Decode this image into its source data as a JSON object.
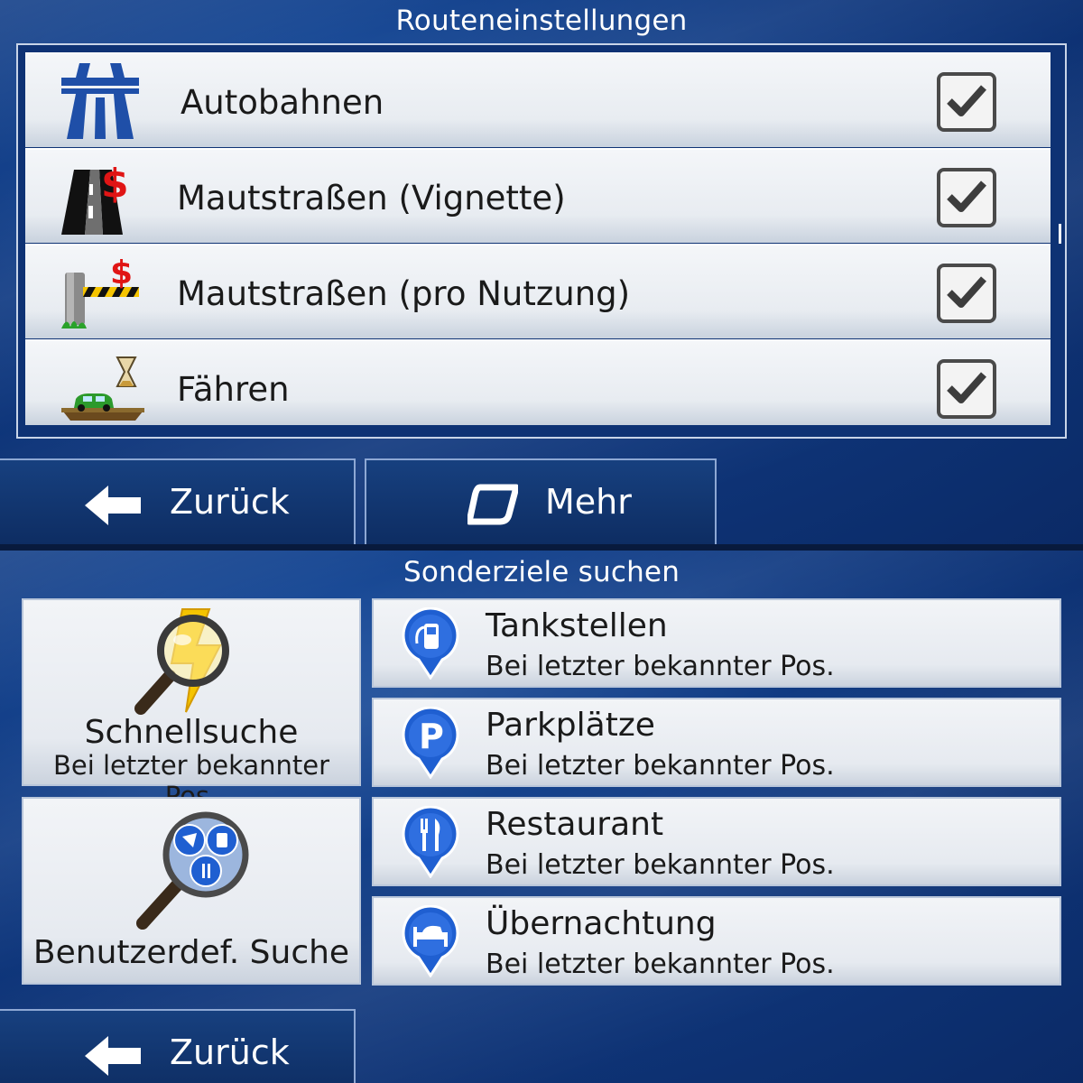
{
  "route_settings": {
    "title": "Routeneinstellungen",
    "items": [
      {
        "label": "Autobahnen",
        "icon": "highway-icon",
        "checked": true
      },
      {
        "label": "Mautstraßen (Vignette)",
        "icon": "toll-vignette-icon",
        "checked": true
      },
      {
        "label": "Mautstraßen (pro Nutzung)",
        "icon": "toll-barrier-icon",
        "checked": true
      },
      {
        "label": "Fähren",
        "icon": "ferry-icon",
        "checked": true
      }
    ],
    "back_label": "Zurück",
    "more_label": "Mehr"
  },
  "poi_search": {
    "title": "Sonderziele suchen",
    "quick_search": {
      "title": "Schnellsuche",
      "subtitle": "Bei letzter bekannter Pos.",
      "icon": "quick-search-icon"
    },
    "custom_search": {
      "title": "Benutzerdef. Suche",
      "icon": "custom-search-icon"
    },
    "categories": [
      {
        "title": "Tankstellen",
        "subtitle": "Bei letzter bekannter Pos.",
        "icon": "fuel-pin-icon"
      },
      {
        "title": "Parkplätze",
        "subtitle": "Bei letzter bekannter Pos.",
        "icon": "parking-pin-icon"
      },
      {
        "title": "Restaurant",
        "subtitle": "Bei letzter bekannter Pos.",
        "icon": "restaurant-pin-icon"
      },
      {
        "title": "Übernachtung",
        "subtitle": "Bei letzter bekannter Pos.",
        "icon": "bed-pin-icon"
      }
    ],
    "back_label": "Zurück"
  },
  "colors": {
    "background": "#103a82",
    "pin_blue": "#1f5fd1",
    "text": "#1a1a1a",
    "toll_red": "#e01515"
  }
}
